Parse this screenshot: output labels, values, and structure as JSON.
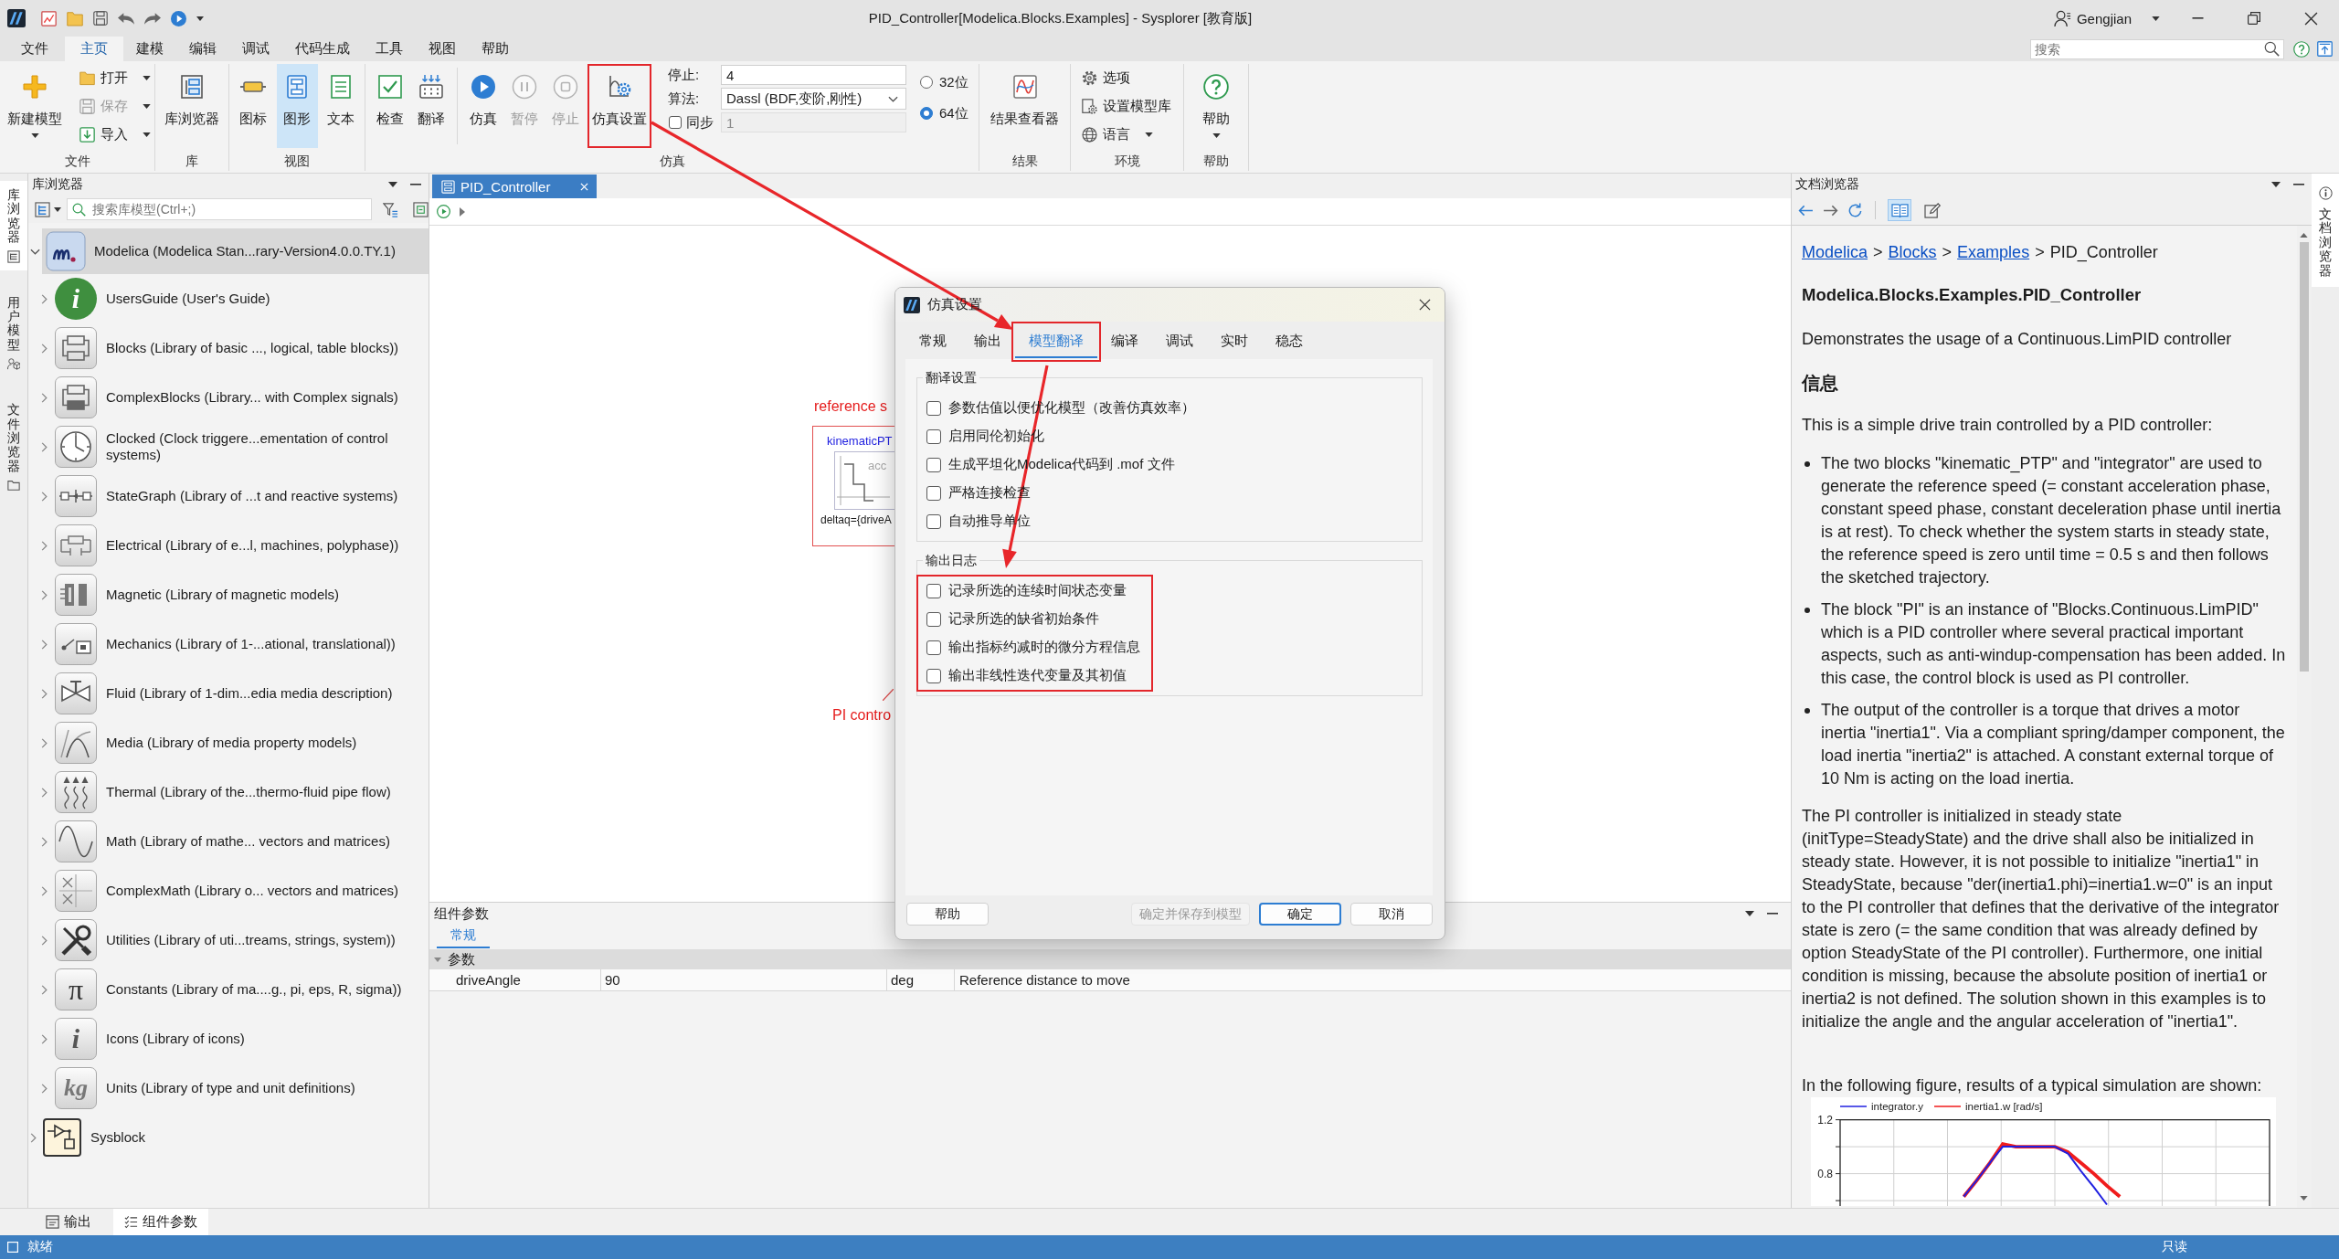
{
  "title_bar": {
    "title": "PID_Controller[Modelica.Blocks.Examples] - Sysplorer [教育版]",
    "user": "Gengjian"
  },
  "menu": [
    {
      "label": "文件",
      "selected": false
    },
    {
      "label": "主页",
      "selected": true
    },
    {
      "label": "建模",
      "selected": false
    },
    {
      "label": "编辑",
      "selected": false
    },
    {
      "label": "调试",
      "selected": false
    },
    {
      "label": "代码生成",
      "selected": false
    },
    {
      "label": "工具",
      "selected": false
    },
    {
      "label": "视图",
      "selected": false
    },
    {
      "label": "帮助",
      "selected": false
    }
  ],
  "search": {
    "placeholder": "搜索"
  },
  "ribbon": [
    {
      "label": "文件",
      "items": [
        {
          "kind": "large",
          "label": "新建模型",
          "dropdown": true,
          "disabled": false
        },
        {
          "kind": "stack",
          "rows": [
            {
              "kind": "button",
              "label": "打开",
              "dropdown": true,
              "disabled": false
            },
            {
              "kind": "button",
              "label": "保存",
              "dropdown": true,
              "disabled": true
            },
            {
              "kind": "button",
              "label": "导入",
              "dropdown": true,
              "disabled": false
            }
          ]
        }
      ]
    },
    {
      "label": "库",
      "items": [
        {
          "kind": "large",
          "label": "库浏览器"
        }
      ]
    },
    {
      "label": "视图",
      "items": [
        {
          "kind": "large",
          "label": "图标",
          "selected": false
        },
        {
          "kind": "large",
          "label": "图形",
          "selected": true
        },
        {
          "kind": "large",
          "label": "文本",
          "selected": false
        }
      ]
    },
    {
      "label": "仿真",
      "items": [
        {
          "kind": "large",
          "label": "检查",
          "disabled": false,
          "highlighted": false
        },
        {
          "kind": "large",
          "label": "翻译",
          "disabled": false,
          "highlighted": false
        },
        {
          "kind": "separator"
        },
        {
          "kind": "large",
          "label": "仿真",
          "disabled": false,
          "highlighted": false
        },
        {
          "kind": "large",
          "label": "暂停",
          "disabled": true,
          "highlighted": false
        },
        {
          "kind": "large",
          "label": "停止",
          "disabled": true,
          "highlighted": false
        },
        {
          "kind": "large",
          "label": "仿真设置",
          "disabled": false,
          "highlighted": true
        },
        {
          "kind": "stack",
          "rows": [
            {
              "kind": "field",
              "label": "停止:",
              "value": "4"
            },
            {
              "kind": "select",
              "label": "算法:",
              "value": "Dassl (BDF,变阶,刚性)"
            },
            {
              "kind": "check_field",
              "label": "同步",
              "checked": false,
              "value": "1",
              "disabled": true
            }
          ]
        },
        {
          "kind": "stack",
          "rows": [
            {
              "kind": "radio",
              "label": "32位",
              "selected": false
            },
            {
              "kind": "radio",
              "label": "64位",
              "selected": true
            }
          ]
        }
      ]
    },
    {
      "label": "结果",
      "items": [
        {
          "kind": "large",
          "label": "结果查看器"
        }
      ]
    },
    {
      "label": "环境",
      "items": [
        {
          "kind": "stack",
          "rows": [
            {
              "kind": "button",
              "label": "选项",
              "dropdown": false
            },
            {
              "kind": "button",
              "label": "设置模型库",
              "dropdown": false
            },
            {
              "kind": "button",
              "label": "语言",
              "dropdown": true
            }
          ]
        }
      ]
    },
    {
      "label": "帮助",
      "items": [
        {
          "kind": "large",
          "label": "帮助",
          "dropdown": true
        }
      ]
    }
  ],
  "side_tabs": [
    {
      "label": "库浏览器",
      "selected": true
    },
    {
      "label": "用户模型",
      "selected": false
    },
    {
      "label": "文件浏览器",
      "selected": false
    }
  ],
  "library_browser": {
    "title": "库浏览器",
    "search": {
      "placeholder": "搜索库模型(Ctrl+;)"
    },
    "tree": [
      {
        "label": "Modelica (Modelica Stan...rary-Version4.0.0.TY.1)",
        "expanded": true,
        "selected": true,
        "children": [
          {
            "label": "UsersGuide (User's Guide)",
            "icon_text": "i",
            "expanded": false,
            "selected": false
          },
          {
            "label": "Blocks (Library of basic ..., logical, table blocks))",
            "expanded": false,
            "selected": false
          },
          {
            "label": "ComplexBlocks (Library... with Complex signals)",
            "expanded": false,
            "selected": false
          },
          {
            "label": "Clocked (Clock triggere...ementation of control systems)",
            "expanded": false,
            "selected": false
          },
          {
            "label": "StateGraph (Library of ...t and reactive systems)",
            "expanded": false,
            "selected": false
          },
          {
            "label": "Electrical (Library of e...l, machines, polyphase))",
            "expanded": false,
            "selected": false
          },
          {
            "label": "Magnetic (Library of magnetic models)",
            "expanded": false,
            "selected": false
          },
          {
            "label": "Mechanics (Library of 1-...ational, translational))",
            "expanded": false,
            "selected": false
          },
          {
            "label": "Fluid (Library of 1-dim...edia media description)",
            "expanded": false,
            "selected": false
          },
          {
            "label": "Media (Library of media property models)",
            "expanded": false,
            "selected": false
          },
          {
            "label": "Thermal (Library of the...thermo-fluid pipe flow)",
            "expanded": false,
            "selected": false
          },
          {
            "label": "Math (Library of mathe... vectors and matrices)",
            "expanded": false,
            "selected": false
          },
          {
            "label": "ComplexMath (Library o... vectors and matrices)",
            "expanded": false,
            "selected": false
          },
          {
            "label": "Utilities (Library of uti...treams, strings, system))",
            "expanded": false,
            "selected": false
          },
          {
            "label": "Constants (Library of ma....g., pi, eps, R, sigma))",
            "icon_text": "π",
            "expanded": false,
            "selected": false
          },
          {
            "label": "Icons (Library of icons)",
            "icon_text": "i",
            "expanded": false,
            "selected": false
          },
          {
            "label": "Units (Library of type and unit definitions)",
            "icon_text": "kg",
            "expanded": false,
            "selected": false
          }
        ]
      },
      {
        "label": "Sysblock",
        "expanded": false,
        "selected": false
      }
    ]
  },
  "editor": {
    "tabs": [
      {
        "label": "PID_Controller",
        "selected": true
      }
    ],
    "diagram": {
      "notes": [
        {
          "text": "reference s"
        },
        {
          "text": "PI contro"
        }
      ],
      "components": [
        {
          "name": "kinematicPT",
          "icon_text": "acc",
          "parameter": "deltaq={driveA"
        }
      ]
    }
  },
  "component_parameters": {
    "title": "组件参数",
    "tabs": [
      {
        "label": "常规",
        "selected": true
      }
    ],
    "groups": [
      {
        "label": "参数",
        "expanded": true,
        "rows": [
          {
            "name": "driveAngle",
            "value": "90",
            "unit": "deg",
            "description": "Reference distance to move"
          }
        ]
      }
    ]
  },
  "doc_browser": {
    "title": "文档浏览器",
    "view_modes": [
      {
        "selected": true
      },
      {
        "selected": false
      }
    ],
    "breadcrumb": [
      {
        "kind": "link",
        "text": "Modelica"
      },
      {
        "kind": "separator",
        "text": ">"
      },
      {
        "kind": "link",
        "text": "Blocks"
      },
      {
        "kind": "separator",
        "text": ">"
      },
      {
        "kind": "link",
        "text": "Examples"
      },
      {
        "kind": "separator",
        "text": ">"
      },
      {
        "kind": "current",
        "text": "PID_Controller"
      }
    ],
    "heading": "Modelica.Blocks.Examples.PID_Controller",
    "summary": "Demonstrates the usage of a Continuous.LimPID controller",
    "section": "信息",
    "intro": "This is a simple drive train controlled by a PID controller:",
    "bullets": [
      "The two blocks \"kinematic_PTP\" and \"integrator\" are used to generate the reference speed (= constant acceleration phase, constant speed phase, constant deceleration phase until inertia is at rest). To check whether the system starts in steady state, the reference speed is zero until time = 0.5 s and then follows the sketched trajectory.",
      "The block \"PI\" is an instance of \"Blocks.Continuous.LimPID\" which is a PID controller where several practical important aspects, such as anti-windup-compensation has been added. In this case, the control block is used as PI controller.",
      "The output of the controller is a torque that drives a motor inertia \"inertia1\". Via a compliant spring/damper component, the load inertia \"inertia2\" is attached. A constant external torque of 10 Nm is acting on the load inertia."
    ],
    "paragraph": "The PI controller is initialized in steady state (initType=SteadyState) and the drive shall also be initialized in steady state. However, it is not possible to initialize \"inertia1\" in SteadyState, because \"der(inertia1.phi)=inertia1.w=0\" is an input to the PI controller that defines that the derivative of the integrator state is zero (= the same condition that was already defined by option SteadyState of the PI controller). Furthermore, one initial condition is missing, because the absolute position of inertia1 or inertia2 is not defined. The solution shown in this examples is to initialize the angle and the angular acceleration of \"inertia1\".",
    "figure_caption": "In the following figure, results of a typical simulation are shown:",
    "chart_data": {
      "type": "line",
      "categories": [
        null,
        null,
        null,
        null,
        null,
        null,
        null,
        null,
        null,
        null,
        null,
        null,
        null,
        null,
        null,
        null,
        null,
        null,
        null,
        null,
        null,
        null,
        null,
        null,
        null,
        null,
        null,
        null,
        null,
        null,
        null,
        null,
        null
      ],
      "series": [
        {
          "name": "integrator.y",
          "color": "#2020e0",
          "values": [
            null,
            null,
            null,
            null,
            null,
            null,
            null,
            null,
            null,
            0.63,
            0.75,
            0.88,
            1,
            1,
            1,
            1,
            1,
            0.95,
            0.82,
            0.7,
            0.57,
            null,
            null,
            null,
            null,
            null,
            null,
            null,
            null,
            null,
            null,
            null,
            null
          ]
        },
        {
          "name": "inertia1.w [rad/s]",
          "color": "#f01c1c",
          "values": [
            null,
            null,
            null,
            null,
            null,
            null,
            null,
            null,
            null,
            0.63,
            0.75,
            0.88,
            1.02,
            1,
            1,
            1,
            1,
            0.96,
            0.88,
            0.8,
            0.71,
            0.63,
            null,
            null,
            null,
            null,
            null,
            null,
            null,
            null,
            null,
            null,
            null
          ]
        }
      ],
      "legend": "top",
      "grid": true,
      "ylim": [
        0.56,
        1.2
      ],
      "yticks": [
        {
          "value": 0.8,
          "label": "0.8"
        },
        {
          "value": 1.2,
          "label": "1.2"
        }
      ]
    }
  },
  "doc_side_tabs": [
    {
      "label": "文档浏览器",
      "selected": true
    }
  ],
  "bottom_tabs": [
    {
      "label": "输出",
      "selected": false
    },
    {
      "label": "组件参数",
      "selected": true
    }
  ],
  "status_bar": {
    "state": "就绪",
    "mode": "只读"
  },
  "dialog": {
    "title": "仿真设置",
    "tabs": [
      {
        "label": "常规",
        "selected": false,
        "highlighted": false
      },
      {
        "label": "输出",
        "selected": false,
        "highlighted": false
      },
      {
        "label": "模型翻译",
        "selected": true,
        "highlighted": true
      },
      {
        "label": "编译",
        "selected": false,
        "highlighted": false
      },
      {
        "label": "调试",
        "selected": false,
        "highlighted": false
      },
      {
        "label": "实时",
        "selected": false,
        "highlighted": false
      },
      {
        "label": "稳态",
        "selected": false,
        "highlighted": false
      }
    ],
    "groups": [
      {
        "title": "翻译设置",
        "highlighted": false,
        "options": [
          {
            "label": "参数估值以便优化模型（改善仿真效率）",
            "checked": false
          },
          {
            "label": "启用同伦初始化",
            "checked": false
          },
          {
            "label": "生成平坦化Modelica代码到 .mof 文件",
            "checked": false
          },
          {
            "label": "严格连接检查",
            "checked": false
          },
          {
            "label": "自动推导单位",
            "checked": false
          }
        ]
      },
      {
        "title": "输出日志",
        "highlighted": true,
        "options": [
          {
            "label": "记录所选的连续时间状态变量",
            "checked": false
          },
          {
            "label": "记录所选的缺省初始条件",
            "checked": false
          },
          {
            "label": "输出指标约减时的微分方程信息",
            "checked": false
          },
          {
            "label": "输出非线性迭代变量及其初值",
            "checked": false
          }
        ]
      }
    ],
    "buttons": [
      {
        "label": "帮助",
        "default": false,
        "disabled": false
      },
      {
        "label": "确定并保存到模型",
        "default": false,
        "disabled": true
      },
      {
        "label": "确定",
        "default": true,
        "disabled": false
      },
      {
        "label": "取消",
        "default": false,
        "disabled": false
      }
    ]
  }
}
